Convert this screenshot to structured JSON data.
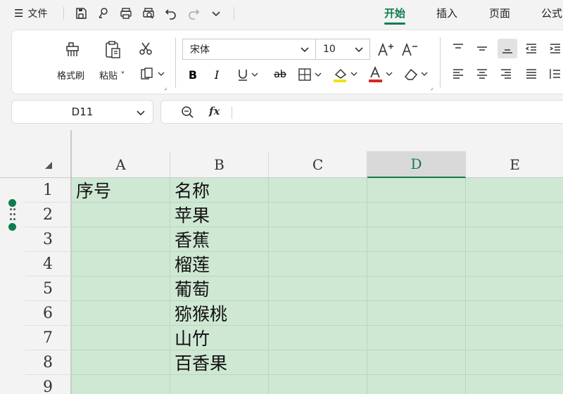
{
  "menu": {
    "label": "文件",
    "burger": "☰"
  },
  "quick_access": [
    "save-icon",
    "cloud-icon",
    "print-icon",
    "print-preview-icon",
    "undo-icon",
    "redo-icon",
    "more-icon"
  ],
  "tabs": [
    {
      "label": "开始",
      "active": true
    },
    {
      "label": "插入",
      "active": false
    },
    {
      "label": "页面",
      "active": false
    },
    {
      "label": "公式",
      "active": false
    }
  ],
  "ribbon": {
    "format_painter": "格式刷",
    "paste": "粘贴",
    "font_name": "宋体",
    "font_size": "10"
  },
  "name_box": "D11",
  "formula_value": "",
  "columns": [
    "A",
    "B",
    "C",
    "D",
    "E"
  ],
  "selected_column": "D",
  "rows": [
    {
      "num": "1",
      "A": "序号",
      "B": "名称"
    },
    {
      "num": "2",
      "A": "",
      "B": "苹果"
    },
    {
      "num": "3",
      "A": "",
      "B": "香蕉"
    },
    {
      "num": "4",
      "A": "",
      "B": "榴莲"
    },
    {
      "num": "5",
      "A": "",
      "B": "葡萄"
    },
    {
      "num": "6",
      "A": "",
      "B": "猕猴桃"
    },
    {
      "num": "7",
      "A": "",
      "B": "山竹"
    },
    {
      "num": "8",
      "A": "",
      "B": "百香果"
    },
    {
      "num": "9",
      "A": "",
      "B": ""
    }
  ],
  "colors": {
    "accent": "#0f7c4f",
    "cell_fill": "#cfe8d3"
  }
}
